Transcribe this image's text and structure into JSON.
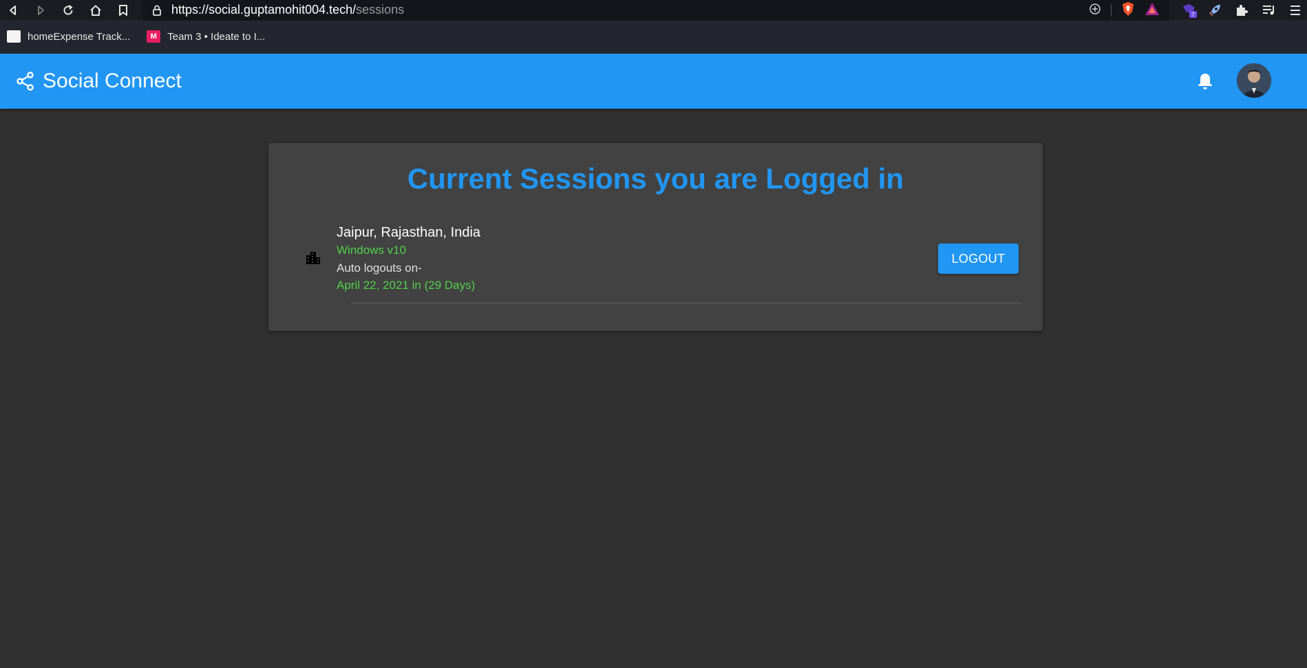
{
  "browser": {
    "url_host": "https://social.guptamohit004.tech/",
    "url_path": "sessions",
    "extension_badge": "7",
    "bookmarks": [
      {
        "label": "homeExpense Track...",
        "icon_color": "#f4f4f4"
      },
      {
        "label": "Team 3 • Ideate to I...",
        "icon_color": "#e91e63"
      }
    ]
  },
  "app": {
    "title": "Social Connect",
    "accent_color": "#2196f3"
  },
  "sessions_page": {
    "heading": "Current Sessions you are Logged in",
    "sessions": [
      {
        "location": "Jaipur, Rajasthan, India",
        "os": "Windows v10",
        "auto_logout_label": "Auto logouts on-",
        "auto_logout_date": "April 22, 2021 in (29 Days)",
        "action_label": "LOGOUT"
      }
    ]
  }
}
